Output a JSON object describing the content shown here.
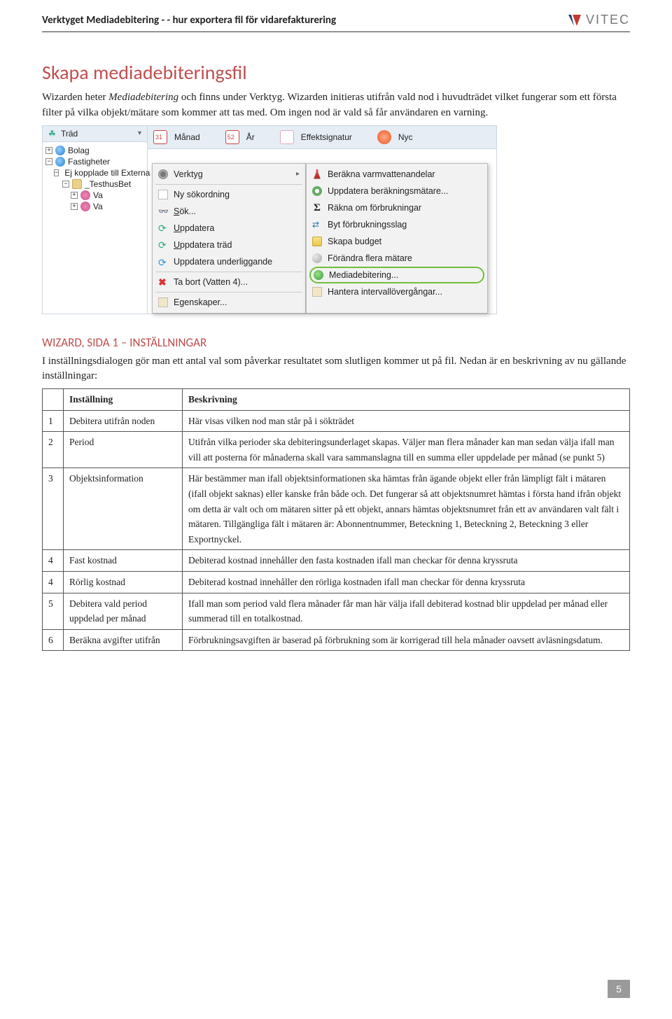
{
  "header": {
    "title": "Verktyget Mediadebitering - - hur exportera fil för vidarefakturering",
    "logo_text": "VITEC"
  },
  "h1": "Skapa mediadebiteringsfil",
  "intro": {
    "seg1": "Wizarden heter ",
    "emph": "Mediadebitering",
    "seg2": " och finns under Verktyg. Wizarden initieras utifrån vald nod i huvudträdet vilket fungerar som ett första filter på vilka objekt/mätare som kommer att tas med. Om ingen nod är vald så får användaren en varning."
  },
  "screenshot": {
    "tree_label": "Träd",
    "toolbar": {
      "month": "Månad",
      "year": "År",
      "effekt": "Effektsignatur",
      "nyc": "Nyc"
    },
    "tree": {
      "bolag": "Bolag",
      "fastigheter": "Fastigheter",
      "ej_kopplade": "Ej kopplade till Externa filter",
      "testhus": "_TesthusBet",
      "va1": "Va",
      "va2": "Va"
    },
    "ctx_menu": [
      "Verktyg",
      "Ny sökordning",
      "Sök...",
      "Uppdatera",
      "Uppdatera träd",
      "Uppdatera underliggande",
      "Ta bort (Vatten 4)...",
      "Egenskaper..."
    ],
    "sub_menu": [
      "Beräkna varmvattenandelar",
      "Uppdatera beräkningsmätare...",
      "Räkna om förbrukningar",
      "Byt förbrukningsslag",
      "Skapa budget",
      "Förändra flera mätare",
      "Mediadebitering...",
      "Hantera intervallövergångar..."
    ]
  },
  "h2": "WIZARD, SIDA 1 – INSTÄLLNINGAR",
  "p2": "I inställningsdialogen gör man ett antal val som påverkar resultatet som slutligen kommer ut på fil. Nedan är en beskrivning av nu gällande inställningar:",
  "table": {
    "head_setting": "Inställning",
    "head_desc": "Beskrivning",
    "rows": [
      {
        "n": "1",
        "s": "Debitera utifrån noden",
        "d": "Här visas vilken nod man står på i sökträdet"
      },
      {
        "n": "2",
        "s": "Period",
        "d": "Utifrån vilka perioder ska debiteringsunderlaget skapas. Väljer man flera månader kan man sedan välja ifall man vill att posterna för månaderna skall vara sammanslagna till en summa eller uppdelade per månad (se punkt 5)"
      },
      {
        "n": "3",
        "s": "Objektsinformation",
        "d": "Här bestämmer man ifall objektsinformationen ska hämtas från ägande objekt eller från lämpligt fält i mätaren (ifall objekt saknas) eller kanske från både och. Det fungerar så att objektsnumret hämtas i första hand ifrån objekt om detta är valt och om mätaren sitter på ett objekt, annars hämtas objektsnumret från ett av användaren valt fält i mätaren. Tillgängliga fält i mätaren är: Abonnentnummer, Beteckning 1, Beteckning 2, Beteckning 3 eller Exportnyckel."
      },
      {
        "n": "4",
        "s": "Fast kostnad",
        "d": "Debiterad kostnad innehåller den fasta kostnaden ifall man checkar för denna kryssruta"
      },
      {
        "n": "4",
        "s": "Rörlig kostnad",
        "d": "Debiterad kostnad innehåller den rörliga kostnaden ifall man checkar för denna kryssruta"
      },
      {
        "n": "5",
        "s": "Debitera vald period uppdelad per månad",
        "d": "Ifall man som period vald flera månader får man här välja ifall debiterad kostnad blir uppdelad per månad eller summerad till en totalkostnad."
      },
      {
        "n": "6",
        "s": "Beräkna avgifter utifrån",
        "d": "Förbrukningsavgiften är baserad på förbrukning som är korrigerad till hela månader oavsett avläsningsdatum."
      }
    ]
  },
  "page_number": "5"
}
